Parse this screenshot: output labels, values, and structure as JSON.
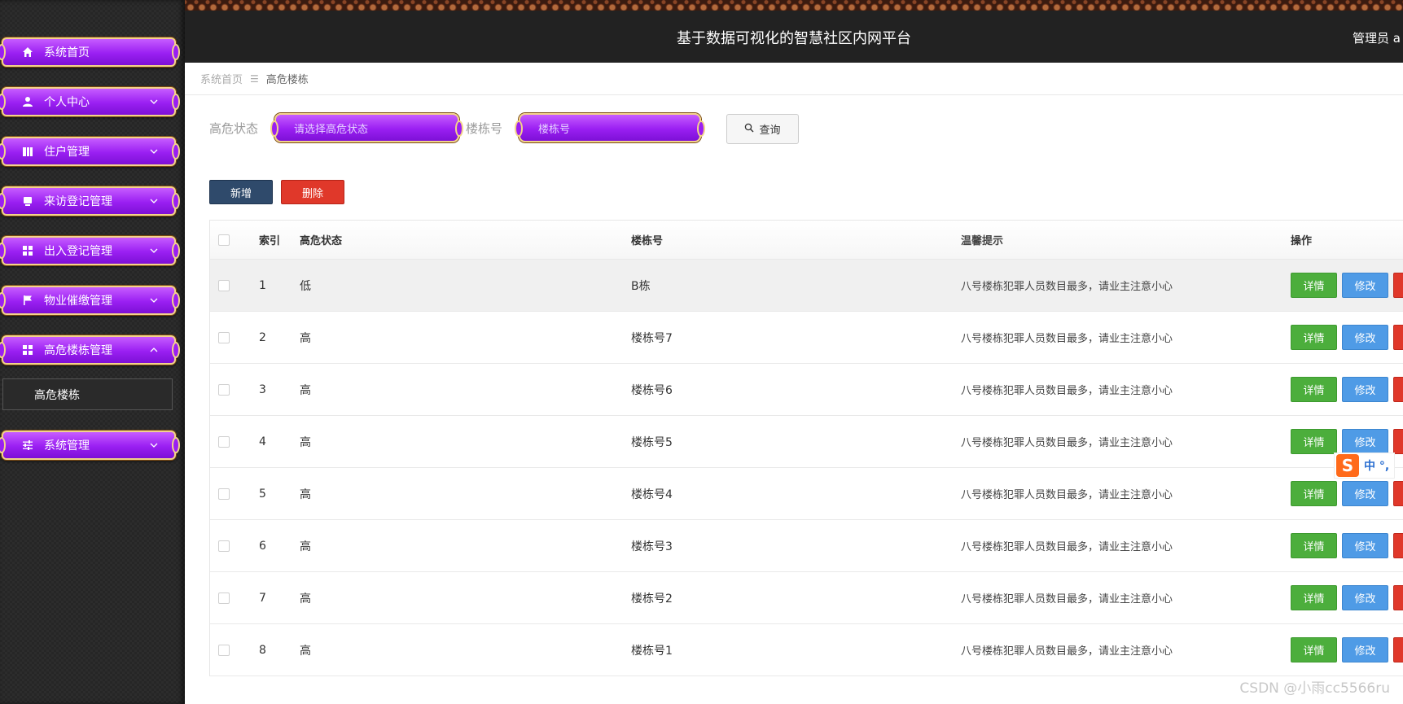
{
  "header": {
    "title": "基于数据可视化的智慧社区内网平台",
    "user": "管理员 a"
  },
  "sidebar": {
    "items": [
      {
        "label": "系统首页",
        "icon": "home-icon"
      },
      {
        "label": "个人中心",
        "icon": "user-icon"
      },
      {
        "label": "住户管理",
        "icon": "building-icon"
      },
      {
        "label": "来访登记管理",
        "icon": "monitor-icon"
      },
      {
        "label": "出入登记管理",
        "icon": "grid-icon"
      },
      {
        "label": "物业催缴管理",
        "icon": "flag-icon"
      },
      {
        "label": "高危楼栋管理",
        "icon": "grid-icon"
      },
      {
        "label": "系统管理",
        "icon": "sliders-icon"
      }
    ],
    "submenu": {
      "label": "高危楼栋"
    }
  },
  "breadcrumb": {
    "home": "系统首页",
    "separator": "☰",
    "current": "高危楼栋"
  },
  "search": {
    "status_label": "高危状态",
    "status_placeholder": "请选择高危状态",
    "building_label": "楼栋号",
    "building_placeholder": "楼栋号",
    "button": "查询"
  },
  "actions": {
    "add": "新增",
    "delete": "删除"
  },
  "table": {
    "columns": [
      "索引",
      "高危状态",
      "楼栋号",
      "温馨提示",
      "操作"
    ],
    "rows": [
      {
        "index": "1",
        "status": "低",
        "building": "B栋",
        "tip": "八号楼栋犯罪人员数目最多，请业主注意小心"
      },
      {
        "index": "2",
        "status": "高",
        "building": "楼栋号7",
        "tip": "八号楼栋犯罪人员数目最多，请业主注意小心"
      },
      {
        "index": "3",
        "status": "高",
        "building": "楼栋号6",
        "tip": "八号楼栋犯罪人员数目最多，请业主注意小心"
      },
      {
        "index": "4",
        "status": "高",
        "building": "楼栋号5",
        "tip": "八号楼栋犯罪人员数目最多，请业主注意小心"
      },
      {
        "index": "5",
        "status": "高",
        "building": "楼栋号4",
        "tip": "八号楼栋犯罪人员数目最多，请业主注意小心"
      },
      {
        "index": "6",
        "status": "高",
        "building": "楼栋号3",
        "tip": "八号楼栋犯罪人员数目最多，请业主注意小心"
      },
      {
        "index": "7",
        "status": "高",
        "building": "楼栋号2",
        "tip": "八号楼栋犯罪人员数目最多，请业主注意小心"
      },
      {
        "index": "8",
        "status": "高",
        "building": "楼栋号1",
        "tip": "八号楼栋犯罪人员数目最多，请业主注意小心"
      }
    ],
    "row_buttons": {
      "detail": "详情",
      "edit": "修改"
    }
  },
  "ime": {
    "label": "中 °,"
  },
  "watermark": "CSDN @小雨cc5566ru",
  "colors": {
    "menu_purple": "#9a1ff2",
    "menu_border": "#f2d38a",
    "btn_add": "#2f4a6b",
    "btn_delete": "#e0382a",
    "btn_detail": "#4cae3c",
    "btn_edit": "#4f9be6"
  }
}
